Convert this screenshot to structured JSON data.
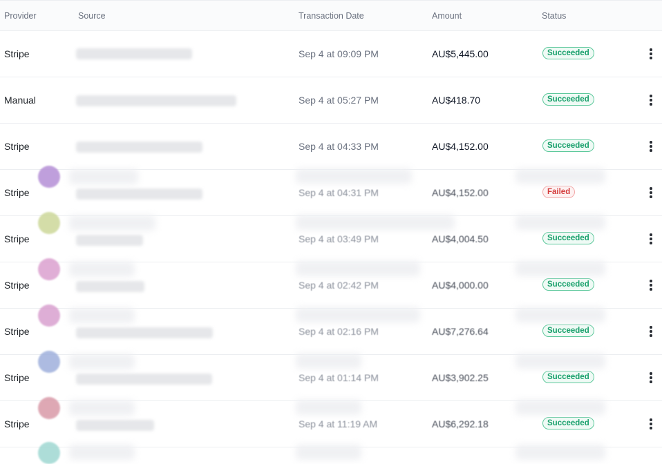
{
  "columns": {
    "provider": "Provider",
    "source": "Source",
    "date": "Transaction Date",
    "amount": "Amount",
    "status": "Status"
  },
  "rows": [
    {
      "provider": "Stripe",
      "date": "Sep 4 at 09:09 PM",
      "amount": "AU$5,445.00",
      "status": "Succeeded",
      "status_kind": "ok"
    },
    {
      "provider": "Manual",
      "date": "Sep 4 at 05:27 PM",
      "amount": "AU$418.70",
      "status": "Succeeded",
      "status_kind": "ok"
    },
    {
      "provider": "Stripe",
      "date": "Sep 4 at 04:33 PM",
      "amount": "AU$4,152.00",
      "status": "Succeeded",
      "status_kind": "ok"
    },
    {
      "provider": "Stripe",
      "date": "Sep 4 at 04:31 PM",
      "amount": "AU$4,152.00",
      "status": "Failed",
      "status_kind": "fail"
    },
    {
      "provider": "Stripe",
      "date": "Sep 4 at 03:49 PM",
      "amount": "AU$4,004.50",
      "status": "Succeeded",
      "status_kind": "ok"
    },
    {
      "provider": "Stripe",
      "date": "Sep 4 at 02:42 PM",
      "amount": "AU$4,000.00",
      "status": "Succeeded",
      "status_kind": "ok"
    },
    {
      "provider": "Stripe",
      "date": "Sep 4 at 02:16 PM",
      "amount": "AU$7,276.64",
      "status": "Succeeded",
      "status_kind": "ok"
    },
    {
      "provider": "Stripe",
      "date": "Sep 4 at 01:14 PM",
      "amount": "AU$3,902.25",
      "status": "Succeeded",
      "status_kind": "ok"
    },
    {
      "provider": "Stripe",
      "date": "Sep 4 at 11:19 AM",
      "amount": "AU$6,292.18",
      "status": "Succeeded",
      "status_kind": "ok"
    }
  ],
  "overlay_avatar_colors": [
    "#b58fd6",
    "#cdd89a",
    "#dba0cf",
    "#d9a0cf",
    "#9fb0dc",
    "#d99aa8",
    "#9fd8d2"
  ],
  "colors": {
    "success_text": "#18a06b",
    "success_border": "#5cc89b",
    "failed_text": "#d43b3b",
    "failed_border": "#f3a8a8"
  }
}
